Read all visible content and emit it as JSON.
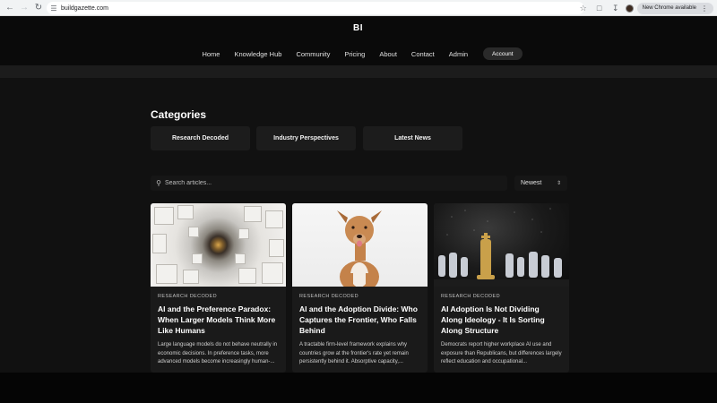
{
  "browser": {
    "url": "buildgazette.com",
    "update_label": "New Chrome available"
  },
  "site": {
    "logo": "BI",
    "nav": [
      "Home",
      "Knowledge Hub",
      "Community",
      "Pricing",
      "About",
      "Contact",
      "Admin"
    ],
    "account_label": "Account"
  },
  "categories": {
    "title": "Categories",
    "items": [
      "Research Decoded",
      "Industry Perspectives",
      "Latest News"
    ]
  },
  "search": {
    "placeholder": "Search articles...",
    "sort_value": "Newest"
  },
  "articles": [
    {
      "category": "RESEARCH DECODED",
      "title": "AI and the Preference Paradox: When Larger Models Think More Like Humans",
      "excerpt": "Large language models do not behave neutrally in economic decisions. In preference tasks, more advanced models become increasingly human-..."
    },
    {
      "category": "RESEARCH DECODED",
      "title": "AI and the Adoption Divide: Who Captures the Frontier, Who Falls Behind",
      "excerpt": "A tractable firm-level framework explains why countries grow at the frontier's rate yet remain persistently behind it. Absorptive capacity,..."
    },
    {
      "category": "RESEARCH DECODED",
      "title": "AI Adoption Is Not Dividing Along Ideology - It Is Sorting Along Structure",
      "excerpt": "Democrats report higher workplace AI use and exposure than Republicans, but differences largely reflect education and occupational..."
    }
  ]
}
